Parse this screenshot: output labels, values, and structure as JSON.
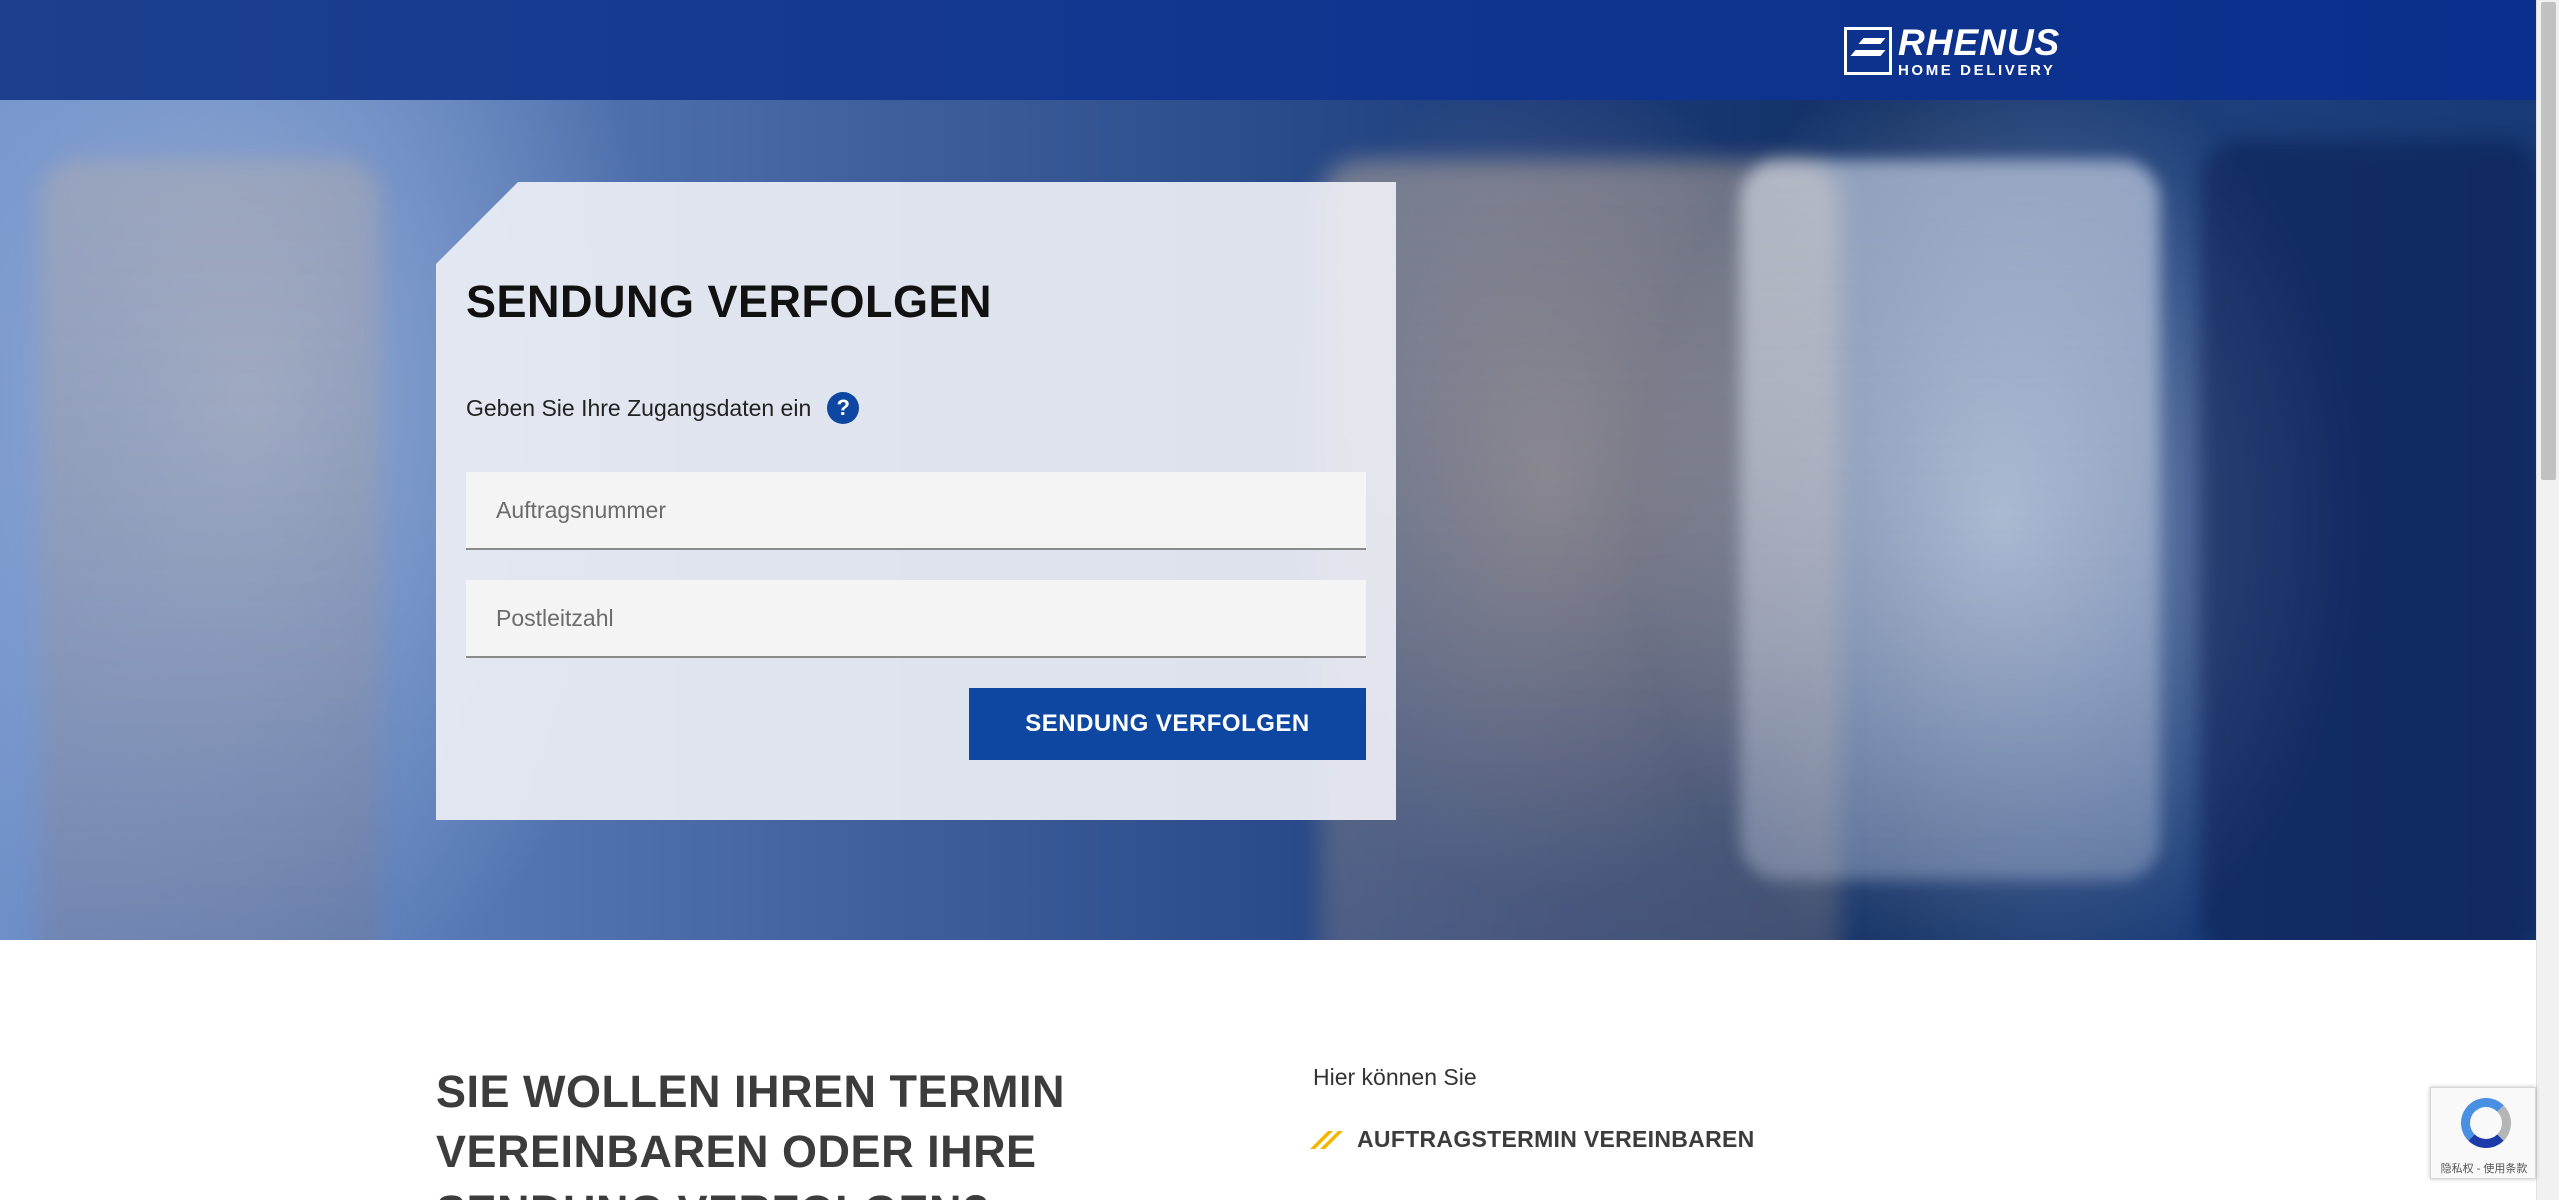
{
  "header": {
    "brand": "RHENUS",
    "brand_subline": "HOME DELIVERY"
  },
  "tracking": {
    "title": "SENDUNG VERFOLGEN",
    "subtitle": "Geben Sie Ihre Zugangsdaten ein",
    "help_icon": "?",
    "order_placeholder": "Auftragsnummer",
    "zip_placeholder": "Postleitzahl",
    "submit_label": "SENDUNG VERFOLGEN"
  },
  "lower": {
    "heading": "SIE WOLLEN IHREN TERMIN VEREINBAREN ODER IHRE SENDUNG VERFOLGEN?",
    "intro": "Hier können Sie",
    "link_label": "AUFTRAGSTERMIN VEREINBAREN"
  },
  "recaptcha": {
    "text": "隐私权 - 使用条款"
  },
  "colors": {
    "header_blue": "#0f3590",
    "button_blue": "#0d47a1",
    "accent_yellow": "#f2b600"
  },
  "icons": {
    "help": "help-icon",
    "link_marker": "double-slash-icon",
    "logo": "rhenus-logo"
  }
}
